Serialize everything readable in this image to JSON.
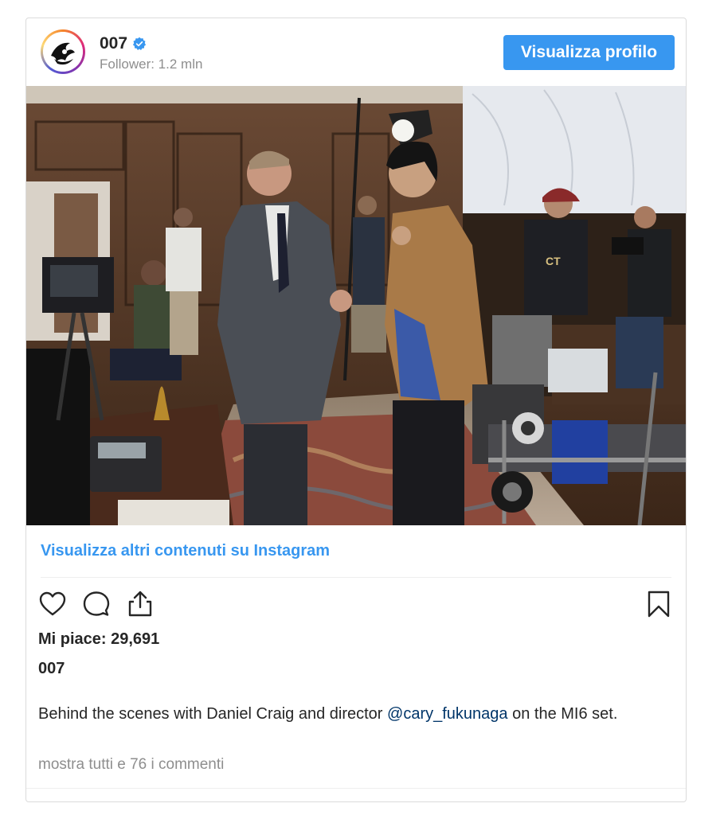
{
  "post": {
    "username": "007",
    "followers": "Follower: 1.2 mln",
    "view_profile_label": "Visualizza profilo",
    "more_on_instagram": "Visualizza altri contenuti su Instagram",
    "likes": "Mi piace: 29,691",
    "caption_user": "007",
    "caption_before": "Behind the scenes with Daniel Craig and director ",
    "caption_mention": "@cary_fukunaga",
    "caption_after": " on the MI6 set.",
    "view_comments": "mostra tutti e 76 i commenti"
  },
  "icons": {
    "verified": "verified-badge-icon",
    "like": "heart-icon",
    "comment": "comment-bubble-icon",
    "share": "share-icon",
    "save": "bookmark-icon"
  },
  "colors": {
    "accent": "#3897f0",
    "mention": "#003569",
    "muted": "#8e8e8e",
    "text": "#262626",
    "border": "#dbdbdb"
  }
}
